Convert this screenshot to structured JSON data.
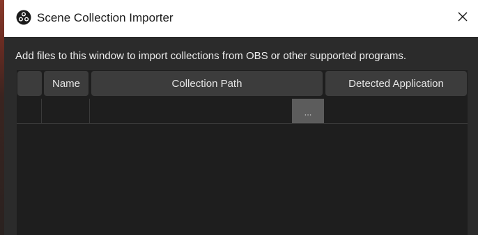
{
  "window": {
    "title": "Scene Collection Importer",
    "app_icon": "obs-logo-icon",
    "close_icon": "close-icon"
  },
  "description": "Add files to this window to import collections from OBS or other supported programs.",
  "table": {
    "columns": [
      "",
      "Name",
      "Collection Path",
      "Detected Application"
    ],
    "rows": [
      {
        "checkbox": "",
        "name": "",
        "collection_path": "",
        "browse_label": "...",
        "detected_application": ""
      }
    ]
  },
  "colors": {
    "titlebar": "#ffffff",
    "background": "#2b2b2b",
    "table_background": "#1e1e1e",
    "header_background": "#3c3c3c",
    "browse_button": "#5c5c5c"
  }
}
